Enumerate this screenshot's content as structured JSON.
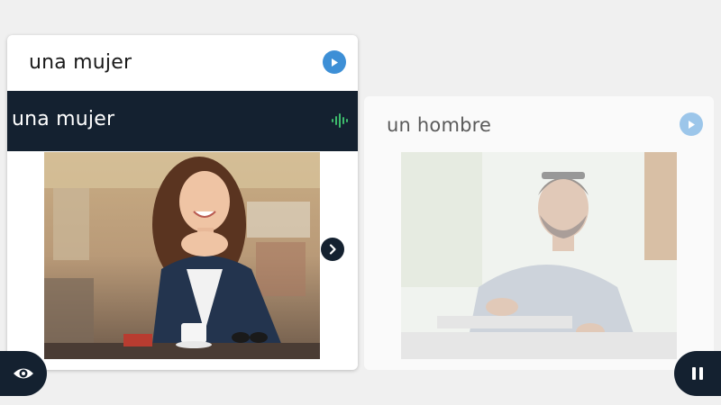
{
  "cards": [
    {
      "prompt": "una mujer",
      "answer": "una mujer",
      "state": "active",
      "image": "woman-laughing-at-cafe",
      "play_icon": "play-icon",
      "voice_icon": "voice-waveform-icon",
      "next_icon": "chevron-right-icon"
    },
    {
      "prompt": "un hombre",
      "state": "inactive",
      "image": "man-writing-at-desk",
      "play_icon": "play-icon"
    }
  ],
  "controls": {
    "reveal_icon": "eye-icon",
    "pause_icon": "pause-icon"
  },
  "colors": {
    "background": "#f0f0f0",
    "dark": "#142130",
    "accent_blue": "#3d8fd6",
    "accent_blue_faded": "#9cc6ea",
    "voice_green": "#3dbb6c"
  }
}
